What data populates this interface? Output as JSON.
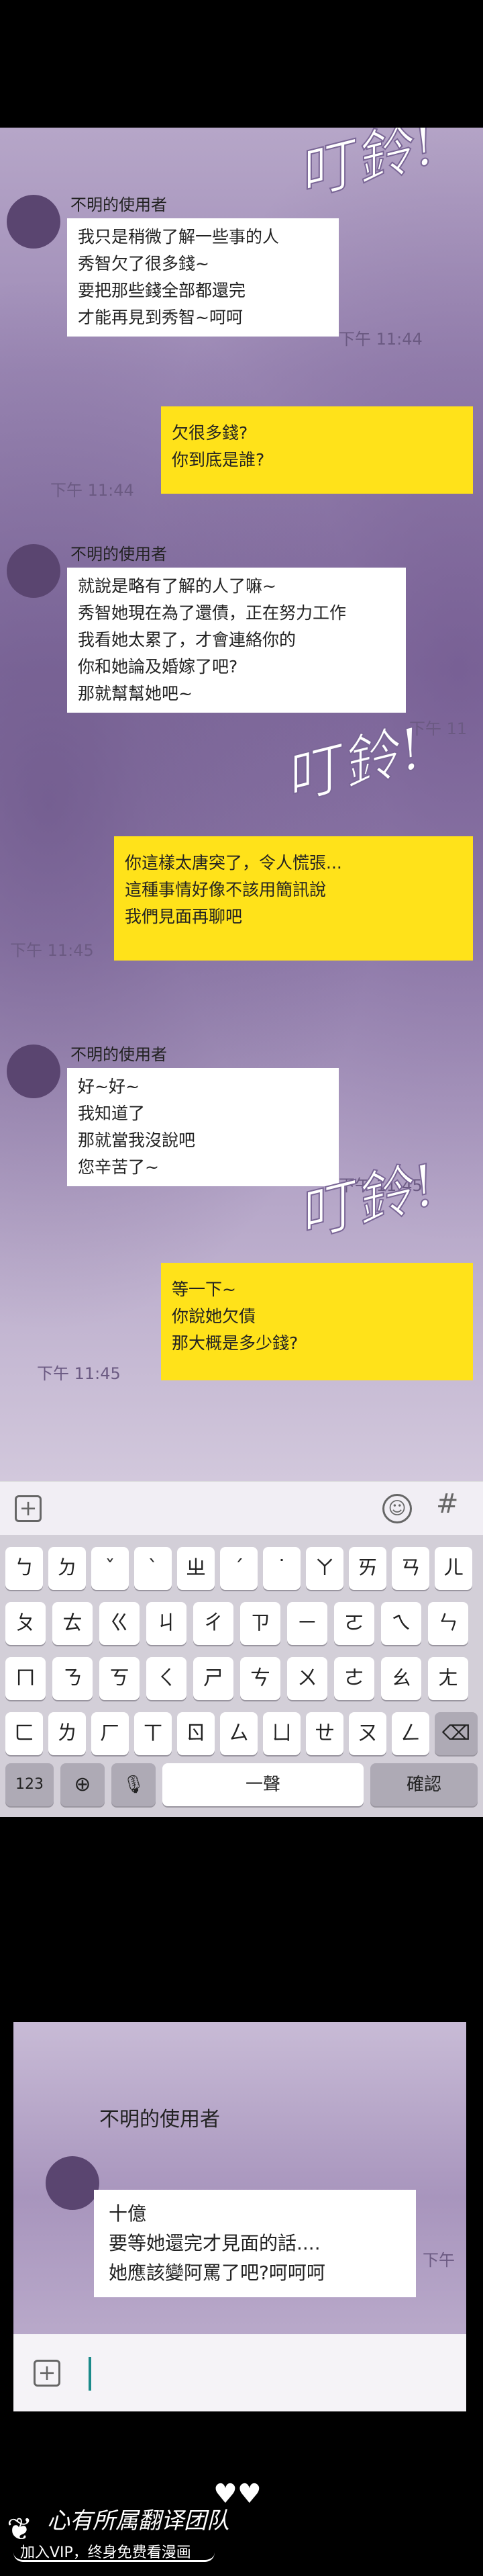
{
  "panel1": {
    "sfx": [
      "叮鈴!",
      "叮鈴!",
      "叮鈴!"
    ],
    "msg1": {
      "sender": "不明的使用者",
      "lines": [
        "我只是稍微了解一些事的人",
        "秀智欠了很多錢~",
        "要把那些錢全部都還完",
        "才能再見到秀智~呵呵"
      ],
      "time": "下午 11:44"
    },
    "msg2": {
      "lines": [
        "欠很多錢?",
        "你到底是誰?"
      ],
      "time": "下午 11:44"
    },
    "msg3": {
      "sender": "不明的使用者",
      "lines": [
        "就說是略有了解的人了嘛~",
        "秀智她現在為了還債，正在努力工作",
        "我看她太累了，才會連絡你的",
        "你和她論及婚嫁了吧?",
        "那就幫幫她吧~"
      ],
      "time": "下午 11"
    },
    "msg4": {
      "lines": [
        "你這樣太唐突了，令人慌張...",
        "這種事情好像不該用簡訊說",
        "我們見面再聊吧"
      ],
      "time": "下午 11:45"
    },
    "msg5": {
      "sender": "不明的使用者",
      "lines": [
        "好~好~",
        "我知道了",
        "那就當我沒說吧",
        "您辛苦了~"
      ],
      "time": "下午 11:45"
    },
    "msg6": {
      "lines": [
        "等一下~",
        "你說她欠債",
        "那大概是多少錢?"
      ],
      "time": "下午 11:45"
    }
  },
  "input_bar": {
    "plus": "+",
    "emoji": "☺",
    "hash": "#"
  },
  "keyboard": {
    "row1": [
      "ㄅ",
      "ㄉ",
      "ˇ",
      "ˋ",
      "ㄓ",
      "ˊ",
      "˙",
      "ㄚ",
      "ㄞ",
      "ㄢ",
      "ㄦ"
    ],
    "row2": [
      "ㄆ",
      "ㄊ",
      "ㄍ",
      "ㄐ",
      "ㄔ",
      "ㄗ",
      "ㄧ",
      "ㄛ",
      "ㄟ",
      "ㄣ"
    ],
    "row3": [
      "ㄇ",
      "ㄋ",
      "ㄎ",
      "ㄑ",
      "ㄕ",
      "ㄘ",
      "ㄨ",
      "ㄜ",
      "ㄠ",
      "ㄤ"
    ],
    "row4": [
      "ㄈ",
      "ㄌ",
      "ㄏ",
      "ㄒ",
      "ㄖ",
      "ㄙ",
      "ㄩ",
      "ㄝ",
      "ㄡ",
      "ㄥ"
    ],
    "backspace": "⌫",
    "num": "123",
    "globe": "⊕",
    "mic": "🎙",
    "space": "一聲",
    "confirm": "確認"
  },
  "panel2": {
    "sender": "不明的使用者",
    "lines": [
      "十億",
      "要等她還完才見面的話....",
      "她應該變阿罵了吧?呵呵呵"
    ],
    "time": "下午",
    "plus": "+"
  },
  "footer": {
    "logo": "心有所属翻译团队",
    "sub": "加入VIP，终身免费看漫画",
    "hearts": "♥♥"
  },
  "colors": {
    "my_bubble": "#ffe21a",
    "their_bubble": "#ffffff",
    "panel_purple": "#9c89b5"
  }
}
